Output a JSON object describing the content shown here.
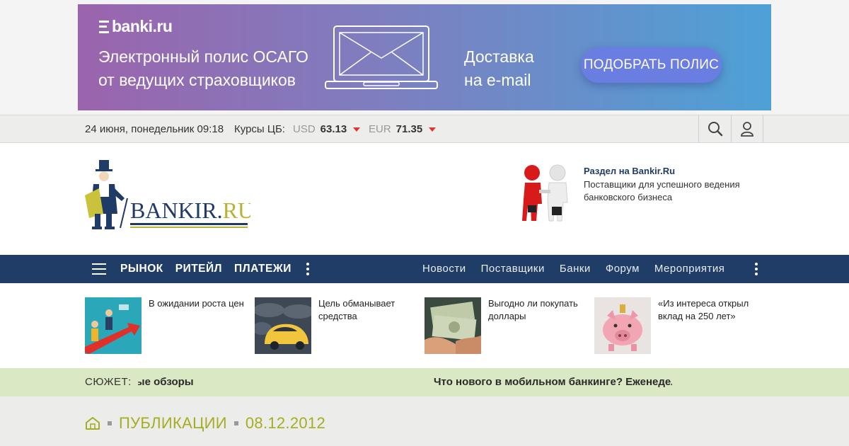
{
  "ad": {
    "logo": "banki.ru",
    "text_line1": "Электронный полис ОСАГО",
    "text_line2": "от ведущих страховщиков",
    "delivery_line1": "Доставка",
    "delivery_line2": "на e-mail",
    "button": "ПОДОБРАТЬ ПОЛИС",
    "colors": {
      "from": "#9b64ad",
      "to": "#4ea1d6",
      "button": "#6a7de0"
    }
  },
  "infobar": {
    "date": "24 июня, понедельник 09:18",
    "rates_label": "Курсы ЦБ:",
    "rates": [
      {
        "currency": "USD",
        "value": "63.13",
        "trend": "down"
      },
      {
        "currency": "EUR",
        "value": "71.35",
        "trend": "down"
      }
    ],
    "icons": [
      "search-icon",
      "user-icon"
    ]
  },
  "header": {
    "logo_text": "BANKIR.RU",
    "promo_title": "Раздел на Bankir.Ru",
    "promo_text": "Поставщики для успешного ведения банковского бизнеса"
  },
  "nav": {
    "main": [
      "РЫНОК",
      "РИТЕЙЛ",
      "ПЛАТЕЖИ"
    ],
    "secondary": [
      "Новости",
      "Поставщики",
      "Банки",
      "Форум",
      "Мероприятия"
    ],
    "color": "#203d68"
  },
  "news": [
    {
      "title": "В ожидании роста цен"
    },
    {
      "title": "Цель обманывает средства"
    },
    {
      "title": "Выгодно ли покупать доллары"
    },
    {
      "title": "«Из интереса открыл вклад на 250 лет»"
    }
  ],
  "story": {
    "label": "СЮЖЕТ:",
    "ticker_1": "льные обзоры",
    "ticker_2": "Что нового в мобильном банкинге? Еженедел"
  },
  "breadcrumb": {
    "section": "ПУБЛИКАЦИИ",
    "date": "08.12.2012",
    "color": "#a6ad20"
  }
}
